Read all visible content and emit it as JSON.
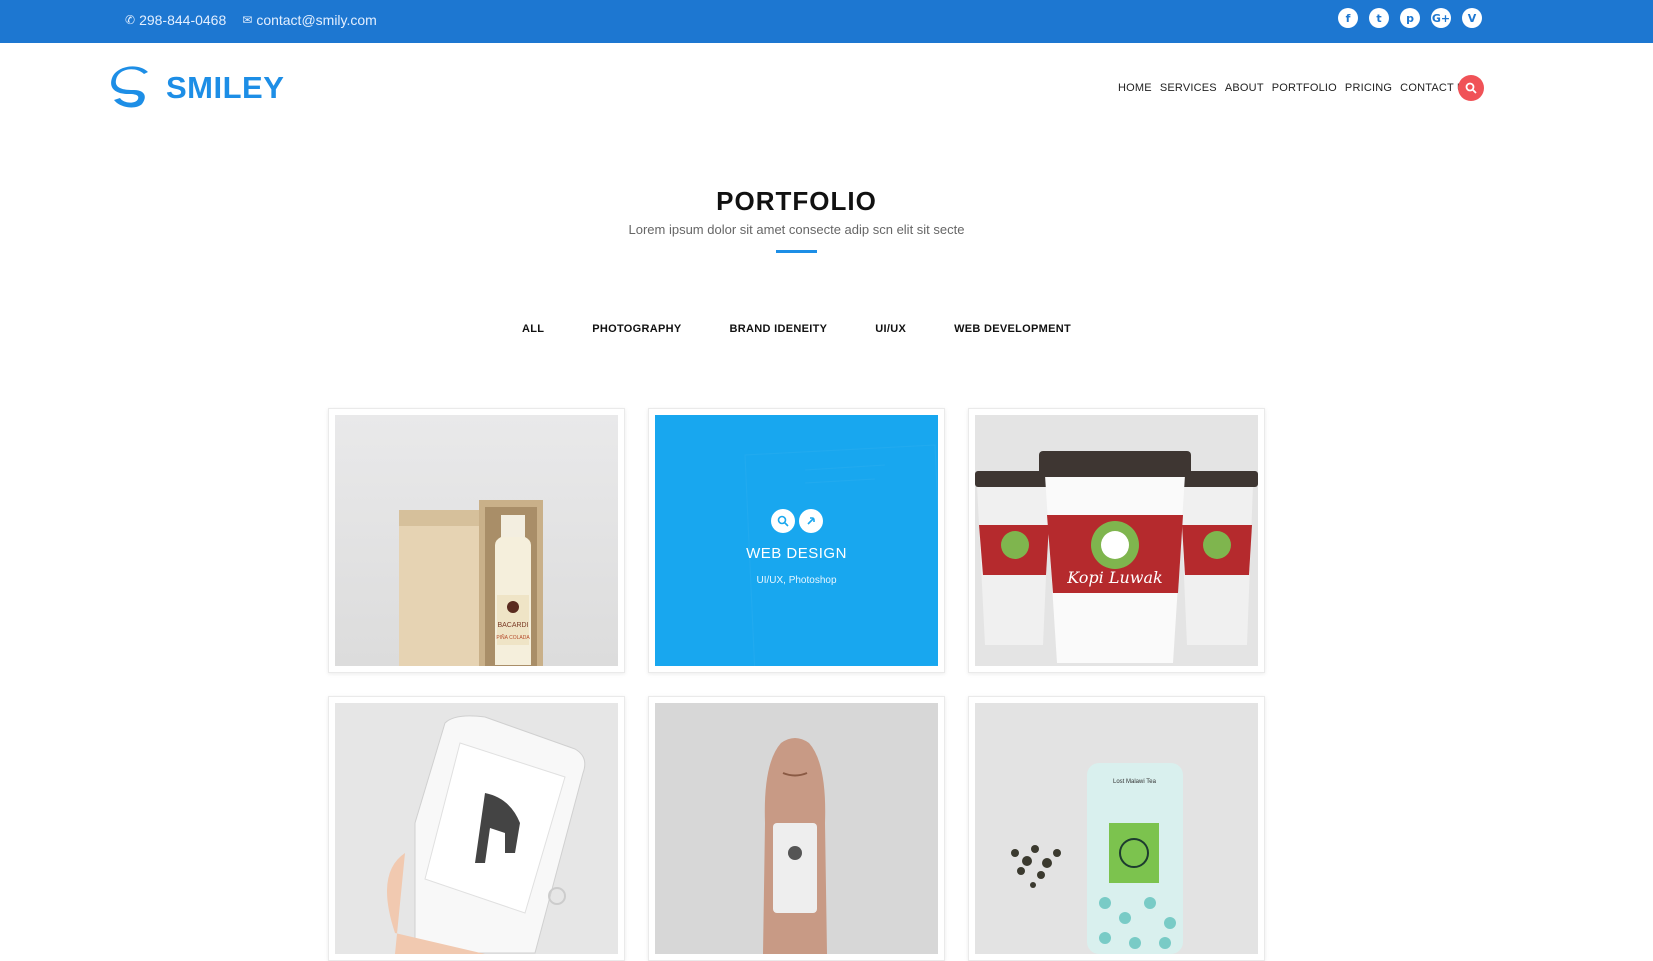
{
  "topbar": {
    "phone": "298-844-0468",
    "email": "contact@smily.com",
    "socials": [
      "f",
      "t",
      "p",
      "G+",
      "V"
    ]
  },
  "brand": {
    "name": "SMILEY"
  },
  "nav": {
    "items": [
      "HOME",
      "SERVICES",
      "ABOUT",
      "PORTFOLIO",
      "PRICING",
      "CONTACT US"
    ]
  },
  "section": {
    "title": "PORTFOLIO",
    "subtitle": "Lorem ipsum dolor sit amet consecte adip scn elit sit secte"
  },
  "filters": [
    "ALL",
    "PHOTOGRAPHY",
    "BRAND IDENEITY",
    "UI/UX",
    "WEB DEVELOPMENT"
  ],
  "portfolio": {
    "hover_item": {
      "title": "WEB DESIGN",
      "tags": "UI/UX, Photoshop"
    },
    "coffee_cup_text": "Kopi Luwak",
    "bottle_label": "BACARDI",
    "bottle_sublabel": "PIÑA COLADA",
    "tea_label": "Lost Malawi Tea"
  },
  "colors": {
    "topbar": "#1d77d1",
    "brand": "#1d8ee6",
    "accent": "#f05257",
    "overlay": "#19a7ee"
  }
}
